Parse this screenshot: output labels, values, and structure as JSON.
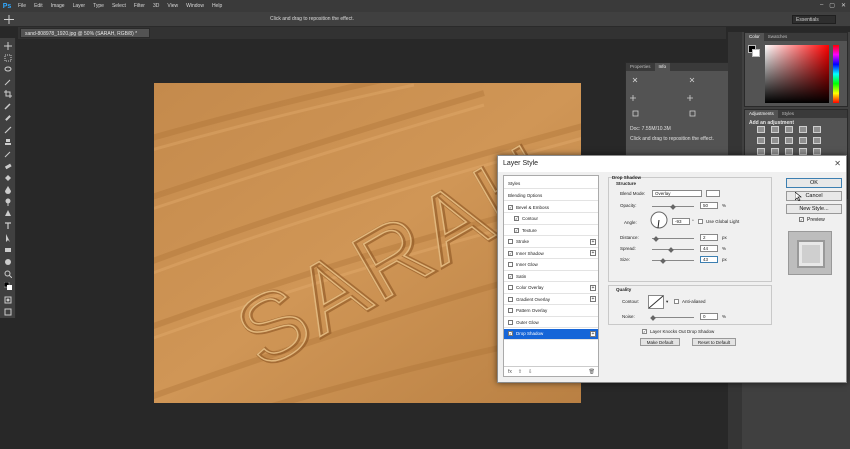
{
  "app": {
    "logo": "Ps"
  },
  "menu": [
    "File",
    "Edit",
    "Image",
    "Layer",
    "Type",
    "Select",
    "Filter",
    "3D",
    "View",
    "Window",
    "Help"
  ],
  "window_controls": [
    "–",
    "▢",
    "✕"
  ],
  "options_bar": {
    "hint": "Click and drag to reposition the effect.",
    "workspace": "Essentials"
  },
  "document": {
    "tab_title": "sand-808978_1920.jpg @ 50% (SARAH, RGB/8) *",
    "text_layer": "SARAH"
  },
  "mid_panel": {
    "tabs": [
      "Properties",
      "Info"
    ],
    "doc_size": "Doc: 7.55M/10.3M",
    "hint": "Click and drag to reposition the effect."
  },
  "color_panel": {
    "tabs": [
      "Color",
      "Swatches"
    ]
  },
  "adjustments_panel": {
    "tabs": [
      "Adjustments",
      "Styles"
    ],
    "title": "Add an adjustment"
  },
  "dialog": {
    "title": "Layer Style",
    "close": "✕",
    "styles_header": "Styles",
    "blending_options": "Blending Options",
    "items": [
      {
        "label": "Bevel & Emboss",
        "checked": true,
        "indent": false,
        "plus": false
      },
      {
        "label": "Contour",
        "checked": true,
        "indent": true,
        "plus": false
      },
      {
        "label": "Texture",
        "checked": true,
        "indent": true,
        "plus": false
      },
      {
        "label": "Stroke",
        "checked": false,
        "indent": false,
        "plus": true
      },
      {
        "label": "Inner Shadow",
        "checked": true,
        "indent": false,
        "plus": true
      },
      {
        "label": "Inner Glow",
        "checked": false,
        "indent": false,
        "plus": false
      },
      {
        "label": "Satin",
        "checked": true,
        "indent": false,
        "plus": false
      },
      {
        "label": "Color Overlay",
        "checked": false,
        "indent": false,
        "plus": true
      },
      {
        "label": "Gradient Overlay",
        "checked": false,
        "indent": false,
        "plus": true
      },
      {
        "label": "Pattern Overlay",
        "checked": false,
        "indent": false,
        "plus": false
      },
      {
        "label": "Outer Glow",
        "checked": false,
        "indent": false,
        "plus": false
      },
      {
        "label": "Drop Shadow",
        "checked": true,
        "indent": false,
        "plus": true,
        "selected": true
      }
    ],
    "footer_icons": [
      "fx",
      "⇧",
      "⇩",
      "🗑"
    ],
    "drop_shadow": {
      "title": "Drop Shadow",
      "structure": "Structure",
      "blend_mode_label": "Blend Mode:",
      "blend_mode_value": "Overlay",
      "opacity_label": "Opacity:",
      "opacity_value": "50",
      "angle_label": "Angle:",
      "angle_value": "-93",
      "use_global_light": "Use Global Light",
      "distance_label": "Distance:",
      "distance_value": "2",
      "spread_label": "Spread:",
      "spread_value": "44",
      "size_label": "Size:",
      "size_value": "43",
      "quality": "Quality",
      "contour_label": "Contour:",
      "anti_aliased": "Anti-aliased",
      "noise_label": "Noise:",
      "noise_value": "0",
      "percent": "%",
      "px": "px",
      "degree": "°",
      "knockout": "Layer Knocks Out Drop Shadow",
      "make_default": "Make Default",
      "reset_default": "Reset to Default"
    },
    "buttons": {
      "ok": "OK",
      "cancel": "Cancel",
      "new_style": "New Style...",
      "preview": "Preview"
    }
  }
}
